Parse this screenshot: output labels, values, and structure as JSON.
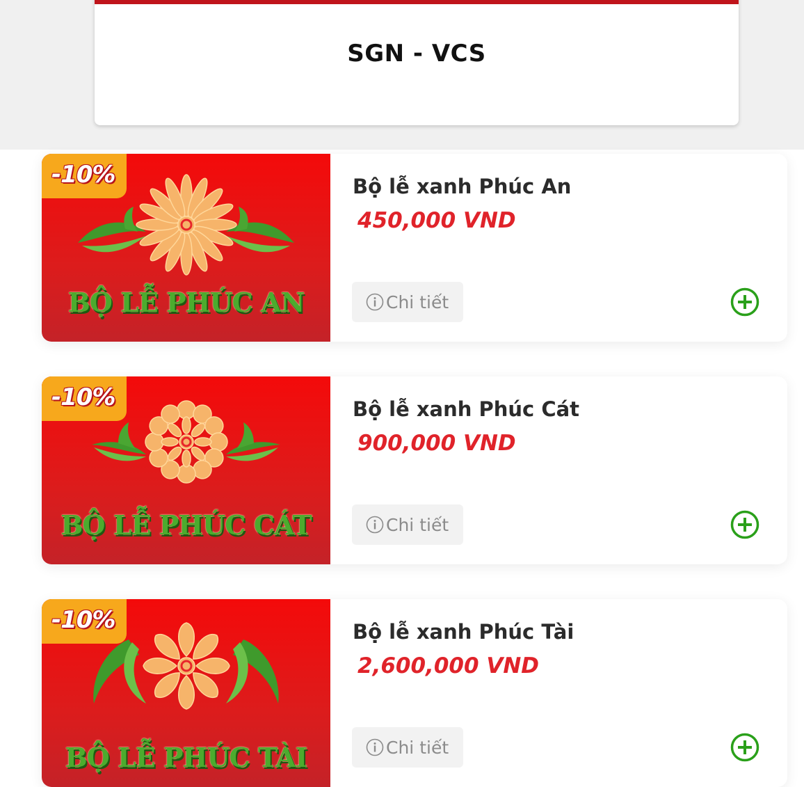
{
  "route": {
    "title": "SGN - VCS"
  },
  "products": [
    {
      "name": "Bộ lễ xanh Phúc An",
      "price": "450,000 VND",
      "badge": "-10%",
      "image_caption": "BỘ LỄ PHÚC AN",
      "detail_label": "Chi tiết"
    },
    {
      "name": "Bộ lễ xanh Phúc Cát",
      "price": "900,000 VND",
      "badge": "-10%",
      "image_caption": "BỘ LỄ PHÚC CÁT",
      "detail_label": "Chi tiết"
    },
    {
      "name": "Bộ lễ xanh Phúc Tài",
      "price": "2,600,000 VND",
      "badge": "-10%",
      "image_caption": "BỘ LỄ PHÚC TÀI",
      "detail_label": "Chi tiết"
    }
  ],
  "colors": {
    "accent_red": "#c0141b",
    "price_red": "#e0232a",
    "add_green": "#2aa01a",
    "badge_orange": "#f7a81c"
  },
  "icons": {
    "info": "info-circle-icon",
    "add": "plus-circle-icon"
  }
}
